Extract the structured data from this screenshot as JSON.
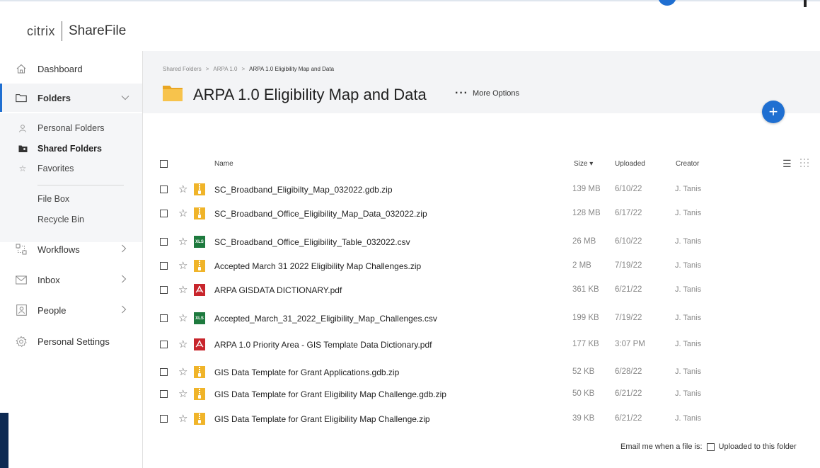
{
  "brand": {
    "citrix": "citrix",
    "product": "ShareFile",
    "accent": "#1f6fd1"
  },
  "sidebar": {
    "items": [
      {
        "label": "Dashboard",
        "icon": "home-icon"
      },
      {
        "label": "Folders",
        "icon": "folder-icon",
        "selected": true,
        "expanded": true
      },
      {
        "label": "Workflows",
        "icon": "workflows-icon"
      },
      {
        "label": "Inbox",
        "icon": "mail-icon"
      },
      {
        "label": "People",
        "icon": "person-icon"
      },
      {
        "label": "Personal Settings",
        "icon": "gear-icon"
      }
    ],
    "subitems": [
      {
        "label": "Personal Folders",
        "icon": "person-icon"
      },
      {
        "label": "Shared Folders",
        "icon": "shared-folder-icon",
        "bold": true
      },
      {
        "label": "Favorites",
        "icon": "star-icon"
      },
      {
        "label": "File Box"
      },
      {
        "label": "Recycle Bin"
      }
    ]
  },
  "breadcrumb": [
    "Shared Folders",
    "ARPA 1.0",
    "ARPA 1.0 Eligibility Map and Data"
  ],
  "breadcrumb_sep": ">",
  "page": {
    "title": "ARPA 1.0 Eligibility Map and Data",
    "more_options": "More Options",
    "add_symbol": "+"
  },
  "table": {
    "headers": {
      "name": "Name",
      "size": "Size ▾",
      "uploaded": "Uploaded",
      "creator": "Creator"
    },
    "rows": [
      {
        "type": "zip",
        "name": "SC_Broadband_Eligibilty_Map_032022.gdb.zip",
        "size": "139 MB",
        "uploaded": "6/10/22",
        "creator": "J. Tanis"
      },
      {
        "type": "zip",
        "name": "SC_Broadband_Office_Eligibility_Map_Data_032022.zip",
        "size": "128 MB",
        "uploaded": "6/17/22",
        "creator": "J. Tanis"
      },
      {
        "type": "xls",
        "name": "SC_Broadband_Office_Eligibility_Table_032022.csv",
        "size": "26 MB",
        "uploaded": "6/10/22",
        "creator": "J. Tanis"
      },
      {
        "type": "zip",
        "name": "Accepted March 31 2022 Eligibility Map Challenges.zip",
        "size": "2 MB",
        "uploaded": "7/19/22",
        "creator": "J. Tanis"
      },
      {
        "type": "pdf",
        "name": "ARPA GISDATA DICTIONARY.pdf",
        "size": "361 KB",
        "uploaded": "6/21/22",
        "creator": "J. Tanis"
      },
      {
        "type": "xls",
        "name": "Accepted_March_31_2022_Eligibility_Map_Challenges.csv",
        "size": "199 KB",
        "uploaded": "7/19/22",
        "creator": "J. Tanis"
      },
      {
        "type": "pdf",
        "name": "ARPA 1.0 Priority Area - GIS Template Data Dictionary.pdf",
        "size": "177 KB",
        "uploaded": "3:07 PM",
        "creator": "J. Tanis"
      },
      {
        "type": "zip",
        "name": "GIS Data Template for Grant Applications.gdb.zip",
        "size": "52 KB",
        "uploaded": "6/28/22",
        "creator": "J. Tanis"
      },
      {
        "type": "zip",
        "name": "GIS Data Template for Grant Eligibility Map Challenge.gdb.zip",
        "size": "50 KB",
        "uploaded": "6/21/22",
        "creator": "J. Tanis"
      },
      {
        "type": "zip",
        "name": "GIS Data Template for Grant Eligibility Map Challenge.zip",
        "size": "39 KB",
        "uploaded": "6/21/22",
        "creator": "J. Tanis"
      }
    ]
  },
  "filetype_badges": {
    "zip": "ZIP",
    "xls": "XLS",
    "pdf": ""
  },
  "email_note": {
    "prefix": "Email me when a file is:",
    "option": "Uploaded to this folder"
  }
}
